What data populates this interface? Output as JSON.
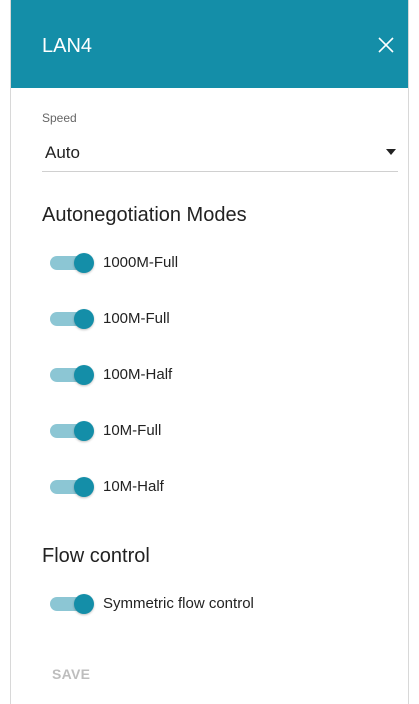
{
  "dialog": {
    "title": "LAN4",
    "close_icon": "close-icon"
  },
  "speed": {
    "label": "Speed",
    "value": "Auto"
  },
  "autoneg": {
    "title": "Autonegotiation Modes",
    "modes": [
      {
        "label": "1000M-Full",
        "enabled": true
      },
      {
        "label": "100M-Full",
        "enabled": true
      },
      {
        "label": "100M-Half",
        "enabled": true
      },
      {
        "label": "10M-Full",
        "enabled": true
      },
      {
        "label": "10M-Half",
        "enabled": true
      }
    ]
  },
  "flow": {
    "title": "Flow control",
    "symmetric_label": "Symmetric flow control",
    "symmetric_enabled": true
  },
  "actions": {
    "save_label": "SAVE"
  },
  "colors": {
    "accent": "#148ea8",
    "accent_light": "#8cc6d4",
    "disabled": "#bdbdbd"
  }
}
